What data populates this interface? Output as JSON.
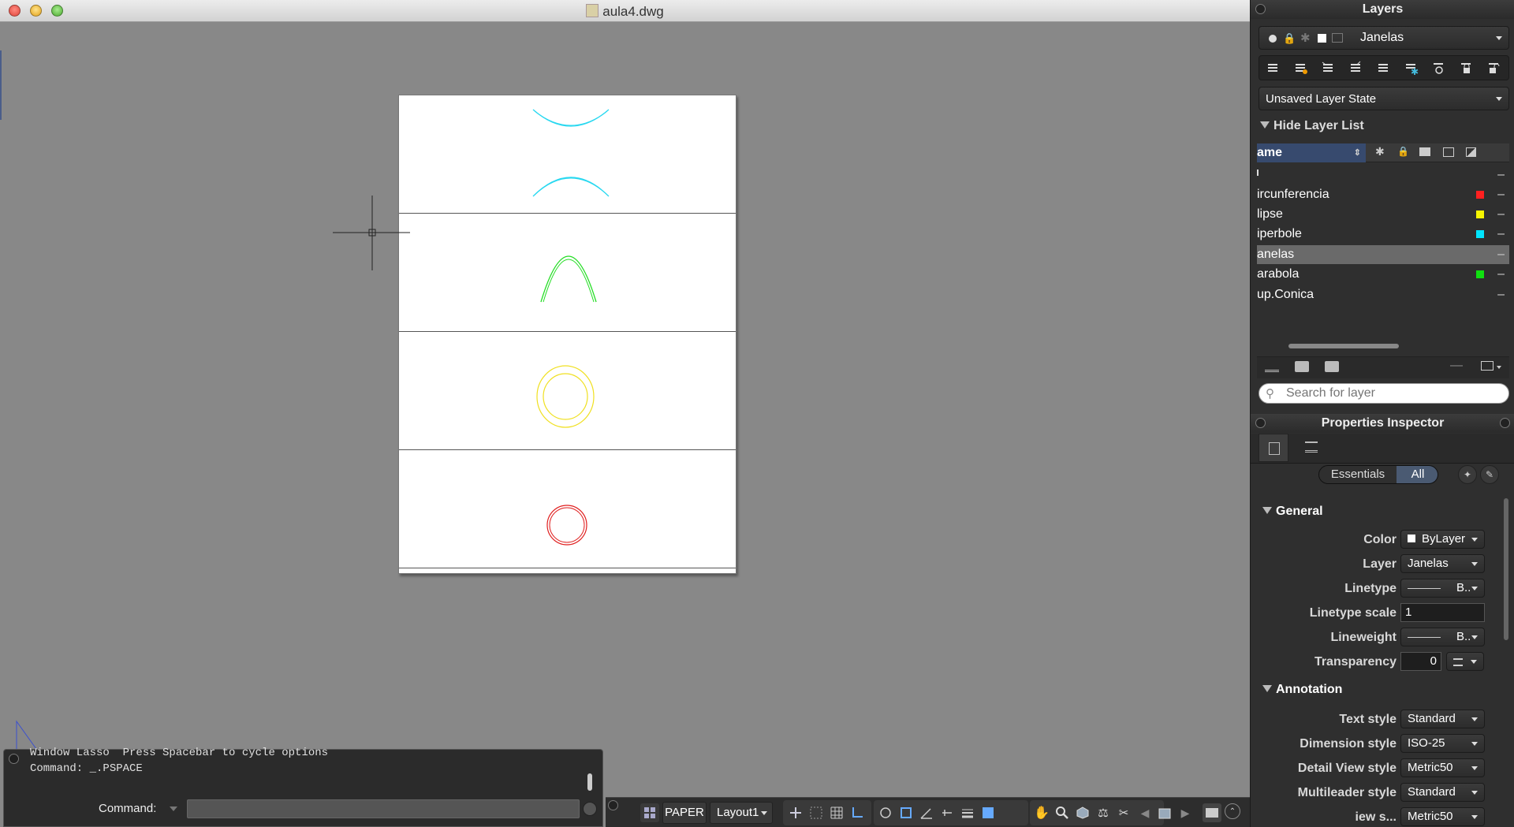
{
  "window": {
    "title": "aula4.dwg"
  },
  "command": {
    "history": [
      "Window Lasso  Press Spacebar to cycle options",
      "Command: _.PSPACE"
    ],
    "label": "Command:",
    "input_value": ""
  },
  "status": {
    "paper_label": "PAPER",
    "layout_label": "Layout1"
  },
  "layers_panel": {
    "title": "Layers",
    "current_layer": "Janelas",
    "layer_state": "Unsaved Layer State",
    "hide_list_label": "Hide Layer List",
    "name_header": "ame",
    "layers": [
      {
        "name": "",
        "color": ""
      },
      {
        "name": "ircunferencia",
        "color": "#ff2020"
      },
      {
        "name": "lipse",
        "color": "#f5f500"
      },
      {
        "name": "iperbole",
        "color": "#00e5ff"
      },
      {
        "name": "anelas",
        "color": ""
      },
      {
        "name": "arabola",
        "color": "#10e010"
      },
      {
        "name": "up.Conica",
        "color": ""
      }
    ],
    "search_placeholder": "Search for layer"
  },
  "properties": {
    "title": "Properties Inspector",
    "tab_essentials": "Essentials",
    "tab_all": "All",
    "general_label": "General",
    "general": [
      {
        "label": "Color",
        "value": "ByLayer"
      },
      {
        "label": "Layer",
        "value": "Janelas"
      },
      {
        "label": "Linetype",
        "value": "B.."
      },
      {
        "label": "Linetype scale",
        "value": "1"
      },
      {
        "label": "Lineweight",
        "value": "B.."
      },
      {
        "label": "Transparency",
        "value": "0"
      }
    ],
    "annotation_label": "Annotation",
    "annotation": [
      {
        "label": "Text style",
        "value": "Standard"
      },
      {
        "label": "Dimension style",
        "value": "ISO-25"
      },
      {
        "label": "Detail View style",
        "value": "Metric50"
      },
      {
        "label": "Multileader style",
        "value": "Standard"
      },
      {
        "label": "iew s...",
        "value": "Metric50"
      }
    ]
  }
}
